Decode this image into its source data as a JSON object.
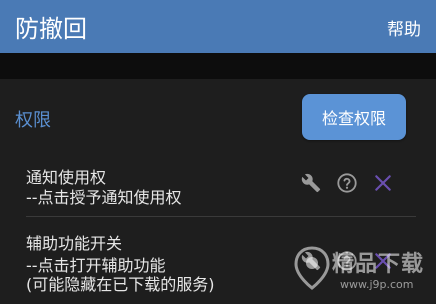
{
  "appbar": {
    "title": "防撤回",
    "help_label": "帮助"
  },
  "colors": {
    "appbar": "#4a7ab5",
    "accent": "#5a8fd0",
    "button": "#5b93d6",
    "background": "#1e1e1e",
    "close_icon": "#6a4fb0",
    "tool_icon": "#9a9a9a"
  },
  "permissions": {
    "section_title": "权限",
    "check_button_label": "检查权限",
    "items": [
      {
        "name": "通知使用权",
        "desc_lines": [
          "--点击授予通知使用权"
        ],
        "icons": [
          "wrench-icon",
          "help-circle-icon",
          "close-icon"
        ]
      },
      {
        "name": "辅助功能开关",
        "desc_lines": [
          "--点击打开辅助功能",
          "(可能隐藏在已下载的服务)"
        ],
        "icons": [
          "wrench-icon",
          "help-circle-icon",
          "close-icon"
        ]
      }
    ]
  },
  "watermark": {
    "text": "精品下载",
    "url": "www.j9p.com"
  }
}
